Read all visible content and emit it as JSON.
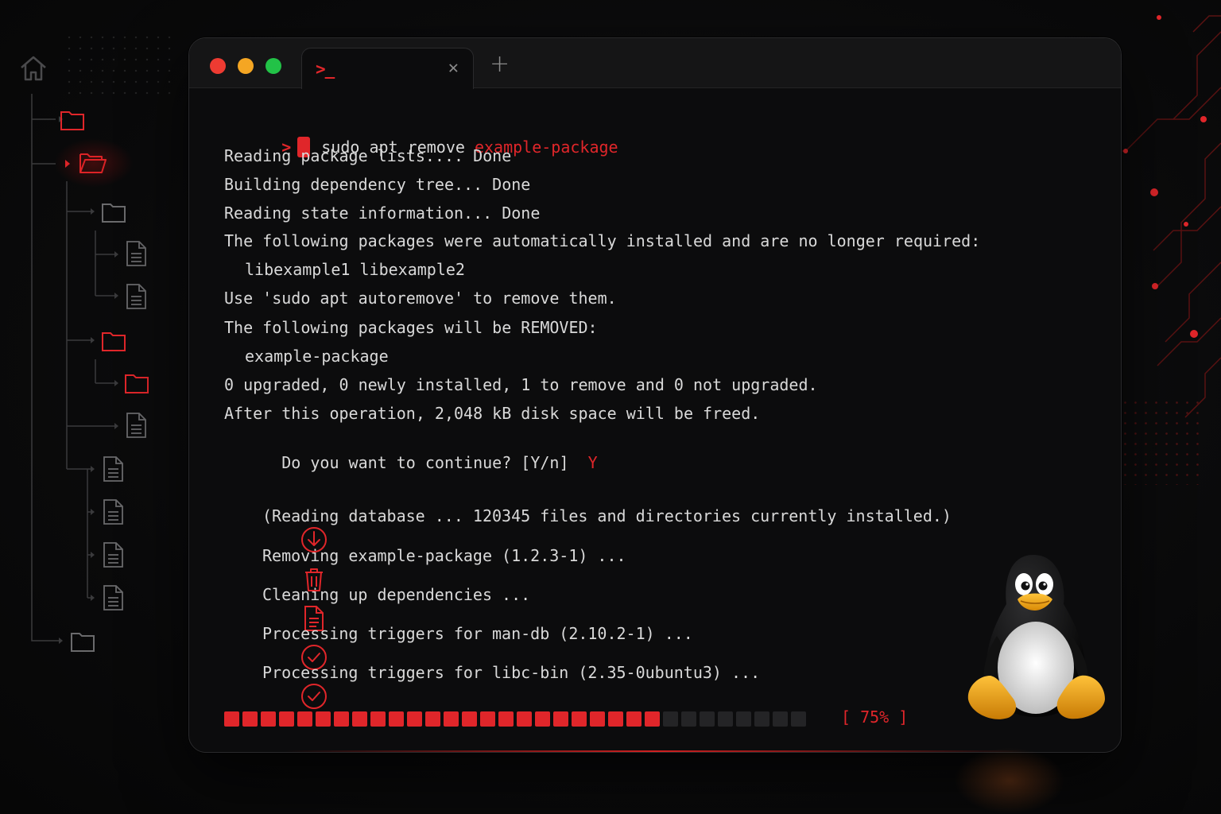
{
  "tab": {
    "icon": "terminal-prompt-icon",
    "icon_glyph": ">_",
    "close_glyph": "✕",
    "new_glyph": "+"
  },
  "terminal": {
    "prompt_symbol": ">",
    "command": "sudo apt remove",
    "command_arg": "example-package",
    "output": [
      "Reading package lists.... Done",
      "Building dependency tree... Done",
      "Reading state information... Done",
      "The following packages were automatically installed and are no longer required:",
      "libexample1 libexample2",
      "Use 'sudo apt autoremove' to remove them.",
      "The following packages will be REMOVED:",
      "example-package",
      "0 upgraded, 0 newly installed, 1 to remove and 0 not upgraded.",
      "After this operation, 2,048 kB disk space will be freed.",
      "Do you want to continue? [Y/n]"
    ],
    "answer": "Y",
    "steps": [
      {
        "icon": "download-icon",
        "text": "(Reading database ... 120345 files and directories currently installed.)"
      },
      {
        "icon": "trash-icon",
        "text": "Removing example-package (1.2.3-1) ..."
      },
      {
        "icon": "document-icon",
        "text": "Cleaning up dependencies ..."
      },
      {
        "icon": "check-circle-icon",
        "text": "Processing triggers for man-db (2.10.2-1) ..."
      },
      {
        "icon": "check-circle-icon",
        "text": "Processing triggers for libc-bin (2.35-0ubuntu3) ..."
      }
    ],
    "progress": {
      "fraction": 0.75,
      "label": "[ 75% ]",
      "total_segments": 32
    }
  },
  "colors": {
    "accent": "#e0262a",
    "text": "#d9d9d9",
    "window_bg": "#0c0c0d",
    "traffic_red": "#ee3b32",
    "traffic_yellow": "#f5a623",
    "traffic_green": "#22c247"
  },
  "sidebar": {
    "icons": [
      "home-icon",
      "folder-icon",
      "file-icon"
    ]
  },
  "mascot": "tux-penguin"
}
